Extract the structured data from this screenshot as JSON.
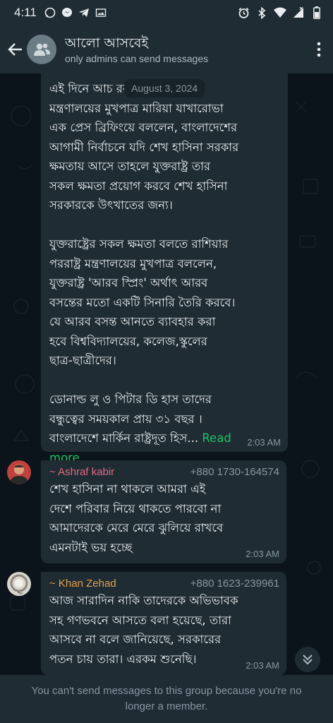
{
  "status_bar": {
    "time": "4:11",
    "left_icons": [
      "whatsapp-icon",
      "messenger-icon",
      "telegram-icon",
      "photo-icon"
    ],
    "right_icons": [
      "alarm-icon",
      "bluetooth-icon",
      "wifi-icon",
      "signal-icon",
      "battery-icon"
    ]
  },
  "header": {
    "group_name": "আলো আসবেই",
    "subtitle": "only admins can send messages"
  },
  "chat": {
    "date_pill": "August 3, 2024",
    "messages": [
      {
        "text": "এই দিনে আচ                                  ররাষ্ট্র\nমন্ত্রণালয়ের মুখপাত্র মারিয়া যাখারোভা\nএক প্রেস ব্রিফিংয়ে বললেন, বাংলাদেশের\nআগামী নির্বাচনে যদি শেখ হাসিনা সরকার\nক্ষমতায় আসে তাহলে যুক্তরাষ্ট্র তার\nসকল ক্ষমতা প্রয়োগ করবে শেখ হাসিনা\nসরকারকে উৎখাতের জন্য।\n\nযুক্তরাষ্ট্রের সকল ক্ষমতা বলতে রাশিয়ার\nপররাষ্ট্র মন্ত্রণালয়ের  মুখপাত্র বললেন,\nযুক্তরাষ্ট্র 'আরব স্প্রিং' অর্থাৎ আরব\nবসন্তের মতো একটি সিনারি তৈরি করবে।\nযে আরব বসন্ত আনতে ব্যাবহার করা\nহবে বিশ্ববিদ্যালয়ের, কলেজ,স্কুলের\nছাত্র-ছাত্রীদের।\n\nডোনাল্ড লু ও পিটার ডি হাস তাদের\nবন্ধুত্বের সময়কাল প্রায় ৩১ বছর ।\nবাংলাদেশে মার্কিন রাষ্ট্রদূত হিস... ",
        "read_more": "Read\nmore",
        "time": "2:03 AM"
      },
      {
        "sender": "~ Ashraf kabir",
        "phone": "+880 1730-164574",
        "text": "শেখ হাসিনা না থাকলে আমরা এই\nদেশে পরিবার নিয়ে থাকতে পারবো না\nআমাদেরকে মেরে মেরে ঝুলিয়ে রাখবে\nএমনটাই ভয় হচ্ছে",
        "time": "2:03 AM"
      },
      {
        "sender": "~ Khan Zehad",
        "phone": "+880 1623-239961",
        "text": "আজ সারাদিন নাকি তাদেরকে অভিভাবক\nসহ গণভবনে আসতে বলা হয়েছে, তারা\nআসবে না বলে জানিয়েছে, সরকারের\nপতন চায় তারা। এরকম শুনেছি।",
        "time": "2:03 AM"
      }
    ]
  },
  "footer": {
    "notice": "You can't send messages to this group because you're no longer a member."
  },
  "colors": {
    "background": "#0b141a",
    "bubble": "#1f2c34",
    "accent_green": "#21c063",
    "sender_ashraf": "#e2697f",
    "sender_khan": "#e6a14b"
  }
}
